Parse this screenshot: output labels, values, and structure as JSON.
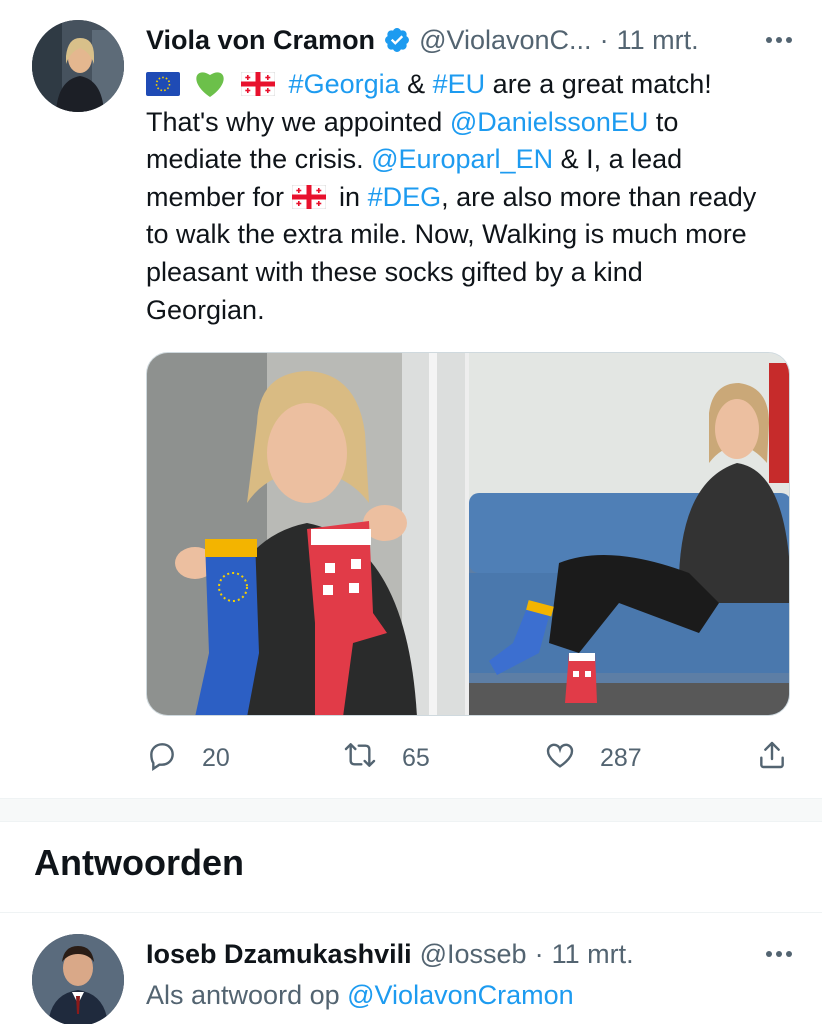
{
  "tweet": {
    "author_name": "Viola von Cramon",
    "author_handle": "@ViolavonC...",
    "dot": "·",
    "time": "11 mrt.",
    "text": {
      "l1_sep1": " ",
      "l1_tag1": "#Georgia",
      "l1_amp": " & ",
      "l1_tag2": "#EU",
      "l1_rest": " are a great match!",
      "l2_pre": "That's why we appointed ",
      "l2_mention": "@DanielssonEU",
      "l2_post": " to",
      "l3_pre": "mediate the crisis. ",
      "l3_mention": "@Europarl_EN",
      "l3_post": " & I, a lead",
      "l4_pre": "member for ",
      "l4_mid": " in ",
      "l4_tag": "#DEG",
      "l4_post": ", are also more than ready",
      "l5": "to walk the extra mile. Now, Walking is much more",
      "l6": "pleasant with these socks gifted by a kind",
      "l7": "Georgian."
    },
    "replies": "20",
    "retweets": "65",
    "likes": "287"
  },
  "section": {
    "title": "Antwoorden"
  },
  "reply": {
    "author_name": "Ioseb Dzamukashvili",
    "author_handle": "@Iosseb",
    "dot": "·",
    "time": "11 mrt.",
    "reply_prefix": "Als antwoord op ",
    "reply_to": "@ViolavonCramon"
  },
  "colors": {
    "link": "#1d9bf0",
    "secondary_text": "#536471",
    "verified": "#1d9bf0",
    "eu_blue": "#1f4bb5",
    "flag_red": "#e8112d",
    "sock_red": "#e13b48"
  },
  "icons": [
    "verified-badge-icon",
    "more-options-icon",
    "eu-flag-icon",
    "green-heart-icon",
    "georgia-flag-icon",
    "reply-icon",
    "retweet-icon",
    "like-icon",
    "share-icon"
  ]
}
